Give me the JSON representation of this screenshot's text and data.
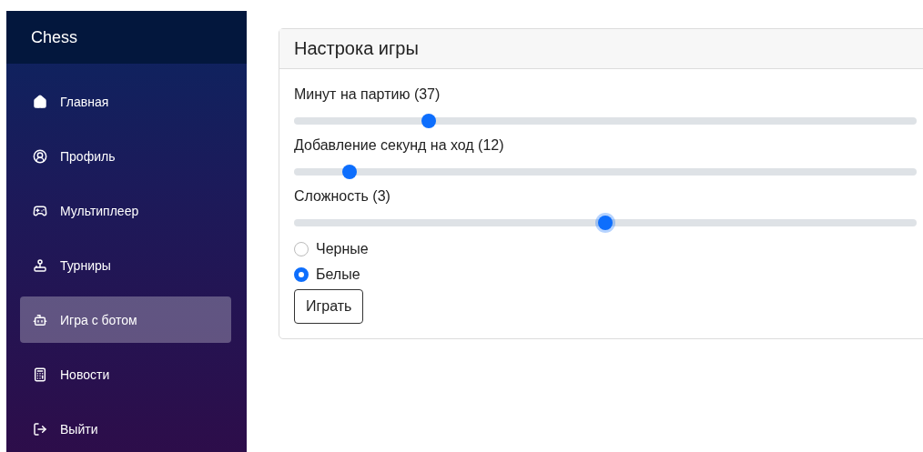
{
  "sidebar": {
    "title": "Chess",
    "items": [
      {
        "label": "Главная",
        "selected": false
      },
      {
        "label": "Профиль",
        "selected": false
      },
      {
        "label": "Мультиплеер",
        "selected": false
      },
      {
        "label": "Турниры",
        "selected": false
      },
      {
        "label": "Игра с ботом",
        "selected": true
      },
      {
        "label": "Новости",
        "selected": false
      },
      {
        "label": "Выйти",
        "selected": false
      }
    ]
  },
  "card": {
    "title": "Настрока игры",
    "sliders": [
      {
        "label": "Минут на партию (37)",
        "level": 0.21,
        "focused": false
      },
      {
        "label": "Добавление секунд на ход (12)",
        "level": 0.08,
        "focused": false
      },
      {
        "label": "Сложность (3)",
        "level": 0.5,
        "focused": true
      }
    ],
    "radios": [
      {
        "label": "Черные",
        "selected": false
      },
      {
        "label": "Белые",
        "selected": true
      }
    ],
    "button": "Играть"
  }
}
